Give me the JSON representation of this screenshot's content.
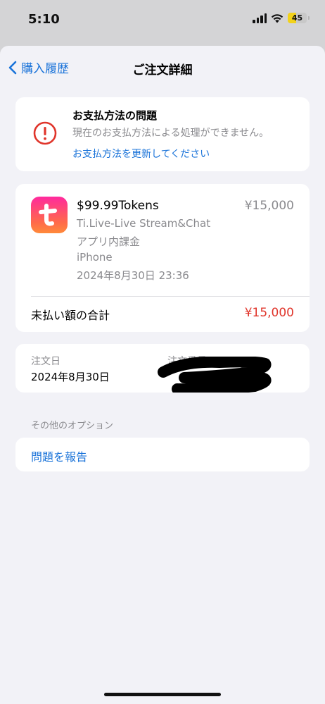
{
  "status_bar": {
    "time": "5:10",
    "battery": "45",
    "battery_fraction": 0.45
  },
  "nav": {
    "back_label": "購入履歴",
    "title": "ご注文詳細"
  },
  "payment_issue": {
    "icon": "exclamation-circle-icon",
    "title": "お支払方法の問題",
    "description": "現在のお支払方法による処理ができません。",
    "link": "お支払方法を更新してください"
  },
  "item": {
    "icon": "app-icon-t",
    "icon_letter": "t",
    "name": "$99.99Tokens",
    "price": "¥15,000",
    "app_name": "Ti.Live-Live Stream&Chat",
    "type": "アプリ内課金",
    "device": "iPhone",
    "date": "2024年8月30日 23:36"
  },
  "total": {
    "label": "未払い額の合計",
    "value": "¥15,000"
  },
  "order": {
    "date_label": "注文日",
    "date_value": "2024年8月30日",
    "number_label": "注文番号"
  },
  "options": {
    "header": "その他のオプション",
    "report_label": "問題を報告"
  },
  "colors": {
    "accent": "#1a73d9",
    "error": "#e0352b",
    "battery": "#f2d21a"
  }
}
